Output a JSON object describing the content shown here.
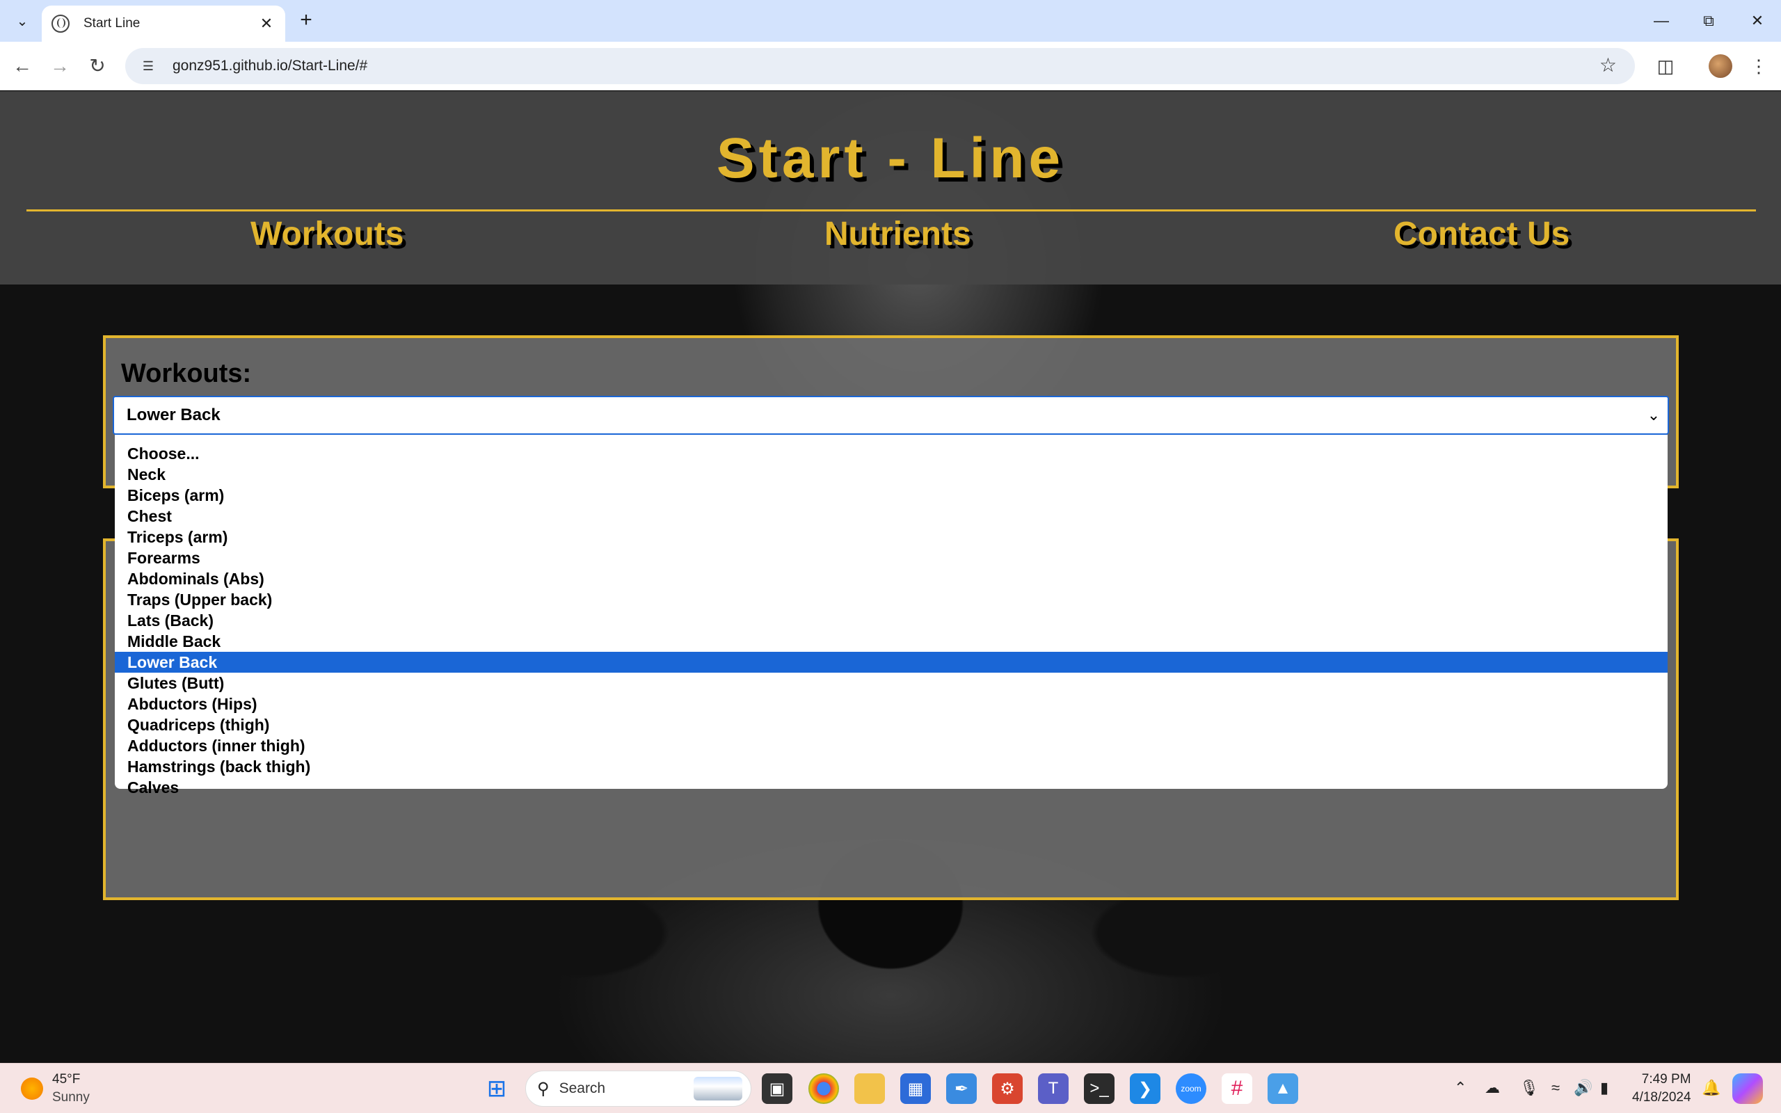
{
  "browser": {
    "tab_title": "Start Line",
    "url": "gonz951.github.io/Start-Line/#"
  },
  "site": {
    "title": "Start - Line",
    "nav": [
      "Workouts",
      "Nutrients",
      "Contact Us"
    ]
  },
  "workouts": {
    "label": "Workouts:",
    "selected": "Lower Back",
    "options": [
      "Choose...",
      "Neck",
      "Biceps (arm)",
      "Chest",
      "Triceps (arm)",
      "Forearms",
      "Abdominals (Abs)",
      "Traps (Upper back)",
      "Lats (Back)",
      "Middle Back",
      "Lower Back",
      "Glutes (Butt)",
      "Abductors (Hips)",
      "Quadriceps (thigh)",
      "Adductors (inner thigh)",
      "Hamstrings (back thigh)",
      "Calves"
    ]
  },
  "taskbar": {
    "weather_temp": "45°F",
    "weather_cond": "Sunny",
    "search_label": "Search",
    "time": "7:49 PM",
    "date": "4/18/2024"
  },
  "colors": {
    "accent": "#e2b52e",
    "select_highlight": "#1a66d6"
  }
}
